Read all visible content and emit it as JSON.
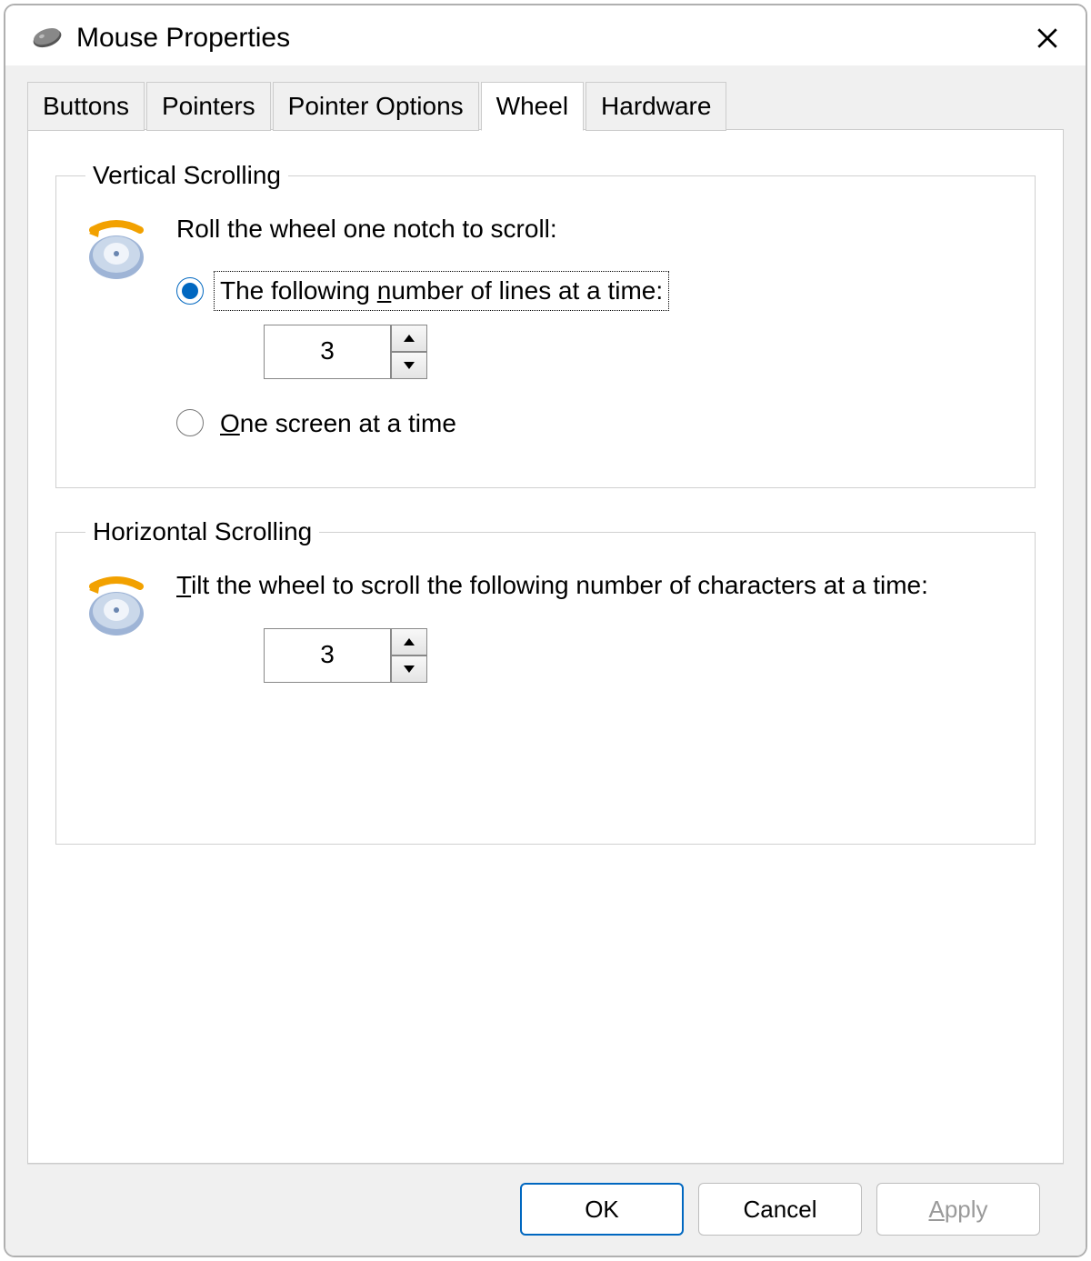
{
  "window": {
    "title": "Mouse Properties"
  },
  "tabs": {
    "buttons": "Buttons",
    "pointers": "Pointers",
    "pointer_options": "Pointer Options",
    "wheel": "Wheel",
    "hardware": "Hardware",
    "active_index": 3
  },
  "vertical": {
    "legend": "Vertical Scrolling",
    "lead": "Roll the wheel one notch to scroll:",
    "radio_lines_prefix": "The following ",
    "radio_lines_u": "n",
    "radio_lines_suffix": "umber of lines at a time:",
    "radio_screen_u": "O",
    "radio_screen_suffix": "ne screen at a time",
    "lines_value": "3",
    "selected": "lines"
  },
  "horizontal": {
    "legend": "Horizontal Scrolling",
    "lead_u": "T",
    "lead_suffix": "ilt the wheel to scroll the following number of characters at a time:",
    "chars_value": "3"
  },
  "buttons": {
    "ok": "OK",
    "cancel": "Cancel",
    "apply_u": "A",
    "apply_suffix": "pply"
  }
}
